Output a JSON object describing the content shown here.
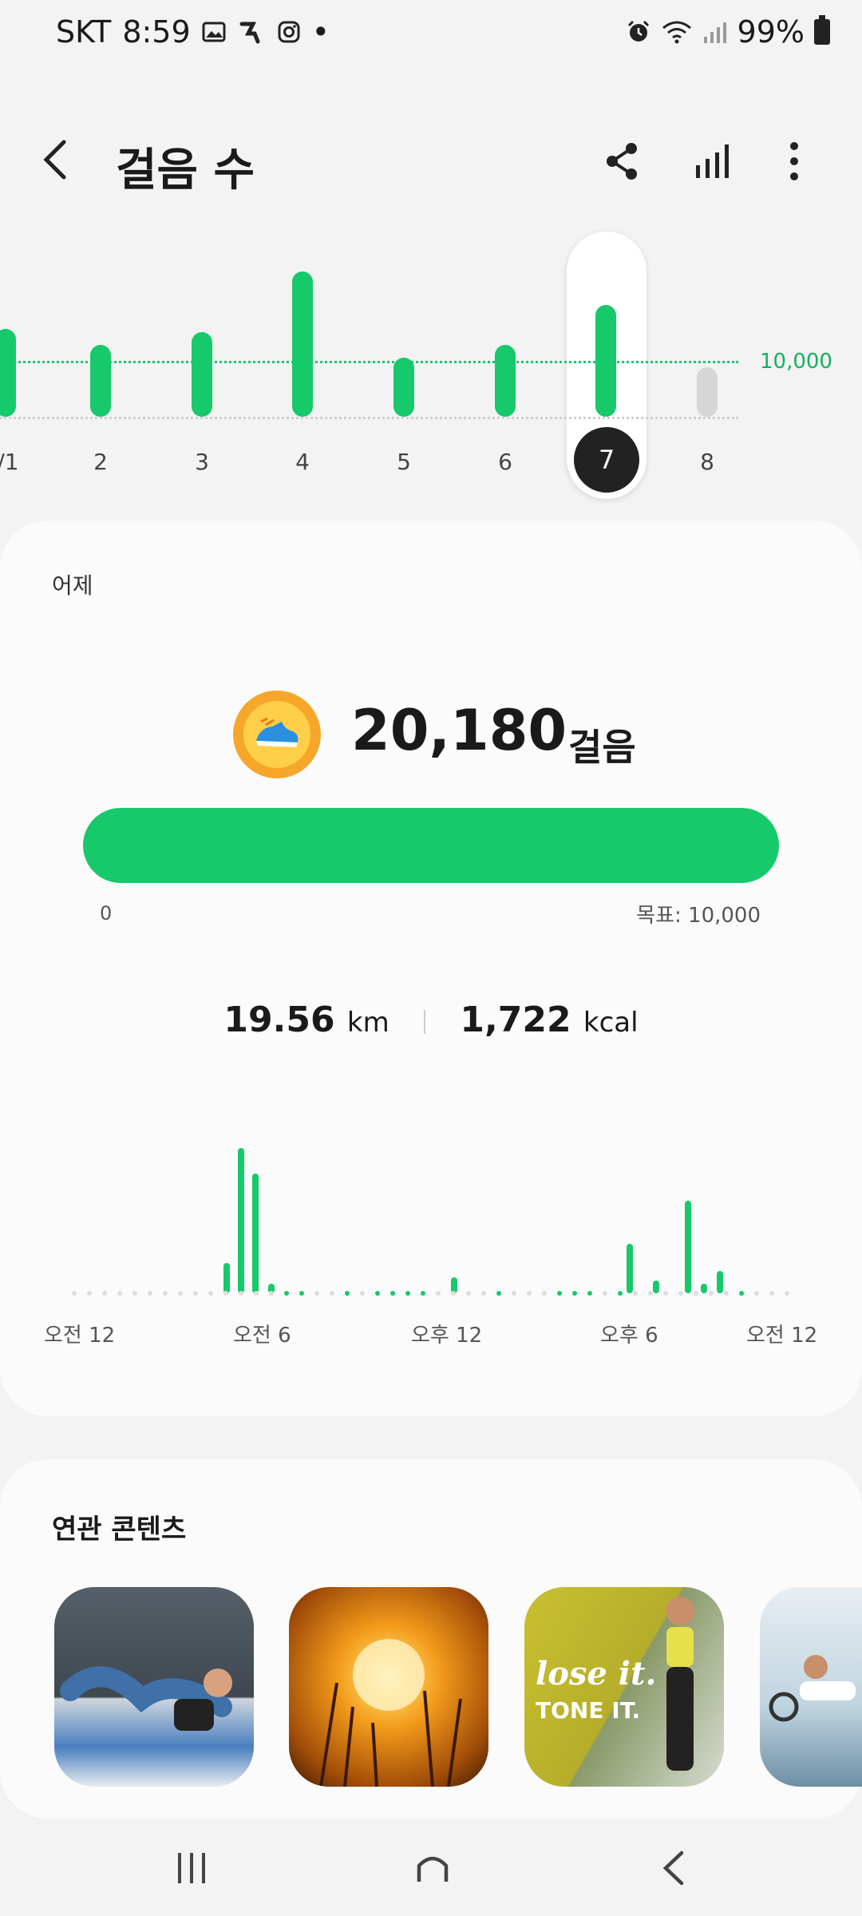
{
  "status_bar": {
    "carrier": "SKT",
    "time": "8:59",
    "dot": "•",
    "battery": "99%"
  },
  "header": {
    "title": "걸음 수"
  },
  "week_chart": {
    "days": [
      "/1",
      "2",
      "3",
      "4",
      "5",
      "6",
      "7",
      "8"
    ],
    "selected_day": "7",
    "goal_label": "10,000"
  },
  "summary": {
    "period_label": "어제",
    "steps": "20,180",
    "steps_unit": "걸음",
    "progress_min": "0",
    "progress_goal": "목표: 10,000",
    "progress_fraction": 1.0,
    "distance": "19.56",
    "distance_unit": "km",
    "calories": "1,722",
    "calories_unit": "kcal"
  },
  "hourly_chart": {
    "labels": [
      "오전 12",
      "오전 6",
      "오후 12",
      "오후 6",
      "오전 12"
    ]
  },
  "related": {
    "title": "연관 콘텐츠",
    "thumb3_text1": "lose it.",
    "thumb3_text2": "TONE IT."
  },
  "colors": {
    "accent": "#16c96b",
    "future_bar": "#d6d6d6"
  }
}
